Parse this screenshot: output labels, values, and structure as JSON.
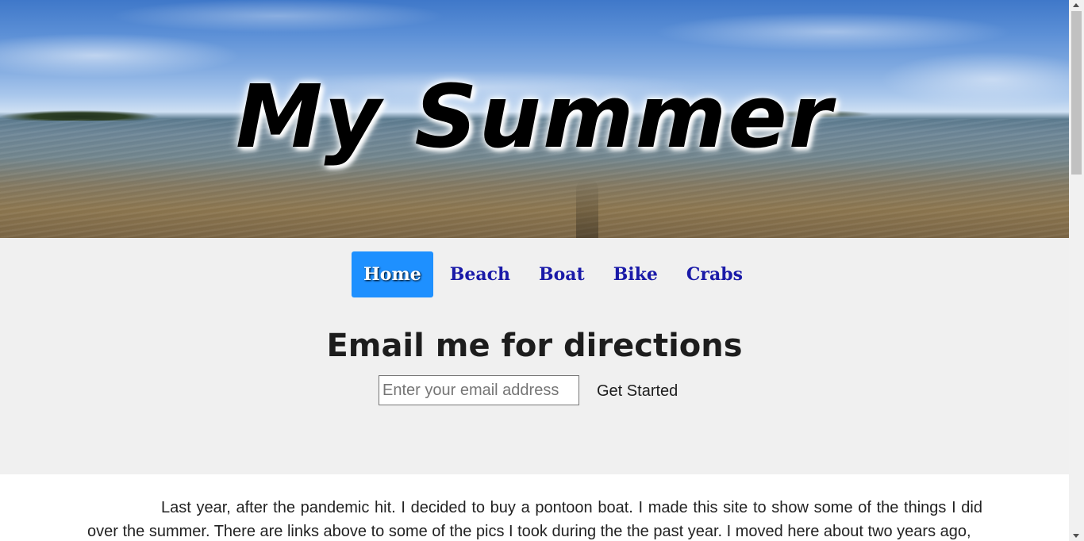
{
  "hero": {
    "title": "My Summer"
  },
  "nav": {
    "items": [
      {
        "label": "Home",
        "active": true
      },
      {
        "label": "Beach",
        "active": false
      },
      {
        "label": "Boat",
        "active": false
      },
      {
        "label": "Bike",
        "active": false
      },
      {
        "label": "Crabs",
        "active": false
      }
    ]
  },
  "signup": {
    "title": "Email me for directions",
    "email_placeholder": "Enter your email address",
    "email_value": "",
    "button_label": "Get Started"
  },
  "content": {
    "paragraph": "Last year, after the pandemic hit. I decided to buy a pontoon boat. I made this site to show some of the things I did over the summer. There are links above to some of the pics I took during the the past year. I moved here about two years ago,"
  },
  "colors": {
    "nav_active_bg": "#1e90ff",
    "nav_link": "#1a1aa8",
    "band_bg": "#f0f0f0"
  }
}
